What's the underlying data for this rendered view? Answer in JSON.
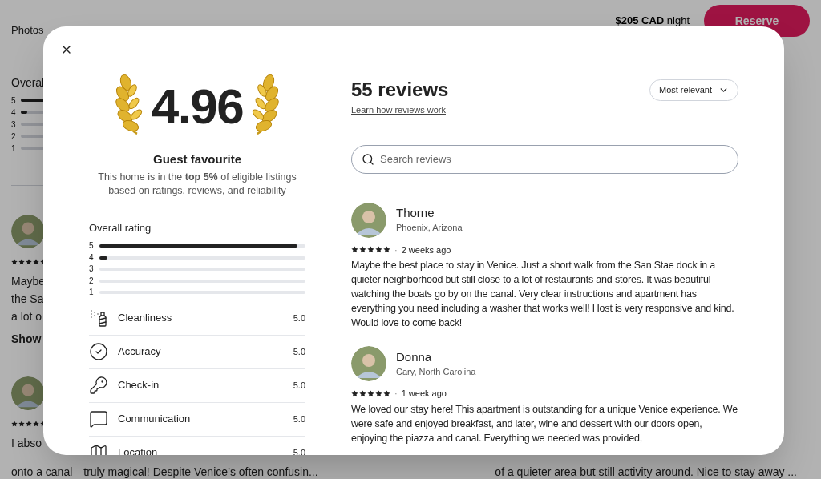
{
  "page": {
    "nav_tabs": [
      {
        "label": "Photos"
      }
    ],
    "price": "$205 CAD",
    "price_unit": "night",
    "reserve_button": "Reserve",
    "overall_label": "Overal",
    "rating_bars": [
      {
        "label": "5",
        "level": 0.95
      },
      {
        "label": "4",
        "level": 0.02
      },
      {
        "label": "3"
      },
      {
        "label": "2"
      },
      {
        "label": "1"
      }
    ],
    "review_snippets": [
      {
        "stars": 5,
        "lines": [
          "Maybe",
          "the Sa",
          "a lot o"
        ],
        "link": "Show"
      },
      {
        "stars": 5,
        "lines": [
          "I abso"
        ]
      }
    ],
    "bottom_left": "onto a canal—truly magical! Despite Venice’s often confusin...",
    "bottom_right": "of a quieter area but still activity around. Nice to stay away ..."
  },
  "modal": {
    "score": "4.96",
    "badge_title": "Guest favourite",
    "badge_text": "This home is in the **top 5%** of eligible listings based on ratings, reviews, and reliability",
    "overall_label": "Overall rating",
    "rating_bars": [
      {
        "label": "5",
        "level": 0.96
      },
      {
        "label": "4",
        "level": 0.04
      },
      {
        "label": "3"
      },
      {
        "label": "2"
      },
      {
        "label": "1"
      }
    ],
    "categories": [
      {
        "label": "Cleanliness",
        "value": "5.0"
      },
      {
        "label": "Accuracy",
        "value": "5.0"
      },
      {
        "label": "Check-in",
        "value": "5.0"
      },
      {
        "label": "Communication",
        "value": "5.0"
      },
      {
        "label": "Location",
        "value": "5.0"
      }
    ],
    "reviews_title": "55 reviews",
    "reviews_link": "Learn how reviews work",
    "sort": "Most relevant",
    "search": {
      "placeholder": "Search reviews"
    },
    "reviews": [
      {
        "name": "Thorne",
        "location": "Phoenix, Arizona",
        "stars": 5,
        "separator": "·",
        "time": "2 weeks ago",
        "text": "Maybe the best place to stay in Venice. Just a short walk from the San Stae dock in a quieter neighborhood but still close to a lot of restaurants and stores. It was beautiful watching the boats go by on the canal. Very clear instructions and apartment has everything you need including a washer that works well! Host is very responsive and kind. Would love to come back!"
      },
      {
        "name": "Donna",
        "location": "Cary, North Carolina",
        "stars": 5,
        "separator": "·",
        "time": "1 week ago",
        "text": "We loved our stay here! This apartment is outstanding for a unique Venice experience. We were safe and enjoyed breakfast, and later, wine and dessert with our doors open, enjoying the piazza and canal. Everything we needed was provided,"
      }
    ]
  }
}
